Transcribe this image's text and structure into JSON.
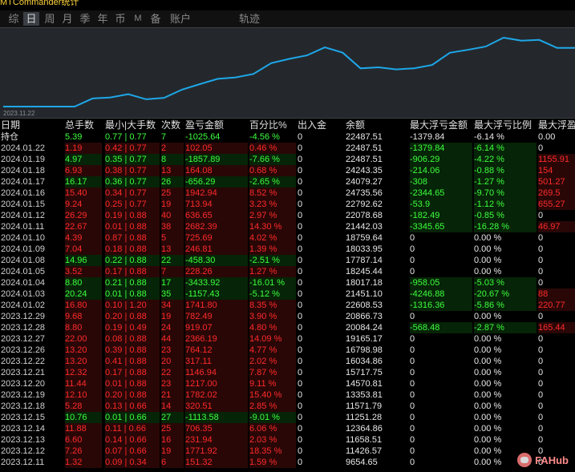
{
  "app": {
    "title": "MTCommander统计"
  },
  "tabs": [
    {
      "label": "综",
      "active": false
    },
    {
      "label": "日",
      "active": true
    },
    {
      "label": "周",
      "active": false
    },
    {
      "label": "月",
      "active": false
    },
    {
      "label": "季",
      "active": false
    },
    {
      "label": "年",
      "active": false
    },
    {
      "label": "币",
      "active": false
    },
    {
      "label": "M",
      "active": false
    },
    {
      "label": "备",
      "active": false
    },
    {
      "label": "账户",
      "active": false
    },
    {
      "label": "轨迹",
      "active": false
    }
  ],
  "chart_data": {
    "type": "line",
    "x_start_label": "2023.11.22",
    "line_color": "#1ea7e8",
    "values": [
      9654.65,
      9654.65,
      9654.65,
      9654.65,
      9654.65,
      11426.57,
      11658.51,
      12364.86,
      11251.28,
      11571.79,
      13353.81,
      14570.81,
      15717.75,
      16034.86,
      16798.98,
      19165.17,
      20084.24,
      20866.73,
      22608.53,
      21451.1,
      18017.18,
      18245.44,
      17787.14,
      18033.95,
      18759.64,
      21442.03,
      22078.68,
      22792.62,
      24735.56,
      24079.27,
      24243.35,
      22487.51,
      22487.51
    ]
  },
  "table": {
    "headers": [
      "日期",
      "总手数",
      "最小|大手数",
      "次数",
      "盈亏金额",
      "百分比%",
      "出入金",
      "余额",
      "最大浮亏金额",
      "最大浮亏比例",
      "最大浮盈"
    ],
    "holding": {
      "cells": [
        "持仓",
        "5.39",
        "0.77 | 0.77",
        "7",
        "-1025.64",
        "-4.56 %",
        "0",
        "22487.51",
        "-1379.84",
        "-6.14 %",
        "0.00"
      ],
      "color": "green"
    },
    "rows": [
      {
        "cells": [
          "2024.01.22",
          "1.19",
          "0.42 | 0.77",
          "2",
          "102.05",
          "0.46 %",
          "0",
          "22487.51",
          "-1379.84",
          "-6.14 %",
          "0"
        ],
        "color": "red",
        "float": "loss"
      },
      {
        "cells": [
          "2024.01.19",
          "4.97",
          "0.35 | 0.77",
          "8",
          "-1857.89",
          "-7.66 %",
          "0",
          "22487.51",
          "-906.29",
          "-4.22 %",
          "1155.91"
        ],
        "color": "green",
        "float": "both"
      },
      {
        "cells": [
          "2024.01.18",
          "6.93",
          "0.38 | 0.77",
          "13",
          "164.08",
          "0.68 %",
          "0",
          "24243.35",
          "-214.06",
          "-0.88 %",
          "154"
        ],
        "color": "red",
        "float": "both"
      },
      {
        "cells": [
          "2024.01.17",
          "16.17",
          "0.36 | 0.77",
          "26",
          "-656.29",
          "-2.65 %",
          "0",
          "24079.27",
          "-308",
          "-1.27 %",
          "501.27"
        ],
        "color": "green",
        "float": "both"
      },
      {
        "cells": [
          "2024.01.16",
          "15.40",
          "0.34 | 0.77",
          "25",
          "1942.94",
          "8.52 %",
          "0",
          "24735.56",
          "-2344.65",
          "-9.70 %",
          "269.5"
        ],
        "color": "red",
        "float": "both"
      },
      {
        "cells": [
          "2024.01.15",
          "9.24",
          "0.25 | 0.77",
          "19",
          "713.94",
          "3.23 %",
          "0",
          "22792.62",
          "-53.9",
          "-1.12 %",
          "655.27"
        ],
        "color": "red",
        "float": "both"
      },
      {
        "cells": [
          "2024.01.12",
          "26.29",
          "0.19 | 0.88",
          "40",
          "636.65",
          "2.97 %",
          "0",
          "22078.68",
          "-182.49",
          "-0.85 %",
          "0"
        ],
        "color": "red",
        "float": "loss"
      },
      {
        "cells": [
          "2024.01.11",
          "22.67",
          "0.01 | 0.88",
          "38",
          "2682.39",
          "14.30 %",
          "0",
          "21442.03",
          "-3345.65",
          "-16.28 %",
          "46.97"
        ],
        "color": "red",
        "float": "both"
      },
      {
        "cells": [
          "2024.01.10",
          "4.39",
          "0.87 | 0.88",
          "5",
          "725.69",
          "4.02 %",
          "0",
          "18759.64",
          "0",
          "0.00 %",
          "0"
        ],
        "color": "red",
        "float": "none"
      },
      {
        "cells": [
          "2024.01.09",
          "7.04",
          "0.18 | 0.88",
          "13",
          "246.81",
          "1.39 %",
          "0",
          "18033.95",
          "0",
          "0.00 %",
          "0"
        ],
        "color": "red",
        "float": "none"
      },
      {
        "cells": [
          "2024.01.08",
          "14.96",
          "0.22 | 0.88",
          "22",
          "-458.30",
          "-2.51 %",
          "0",
          "17787.14",
          "0",
          "0.00 %",
          "0"
        ],
        "color": "green",
        "float": "none"
      },
      {
        "cells": [
          "2024.01.05",
          "3.52",
          "0.17 | 0.88",
          "7",
          "228.26",
          "1.27 %",
          "0",
          "18245.44",
          "0",
          "0.00 %",
          "0"
        ],
        "color": "red",
        "float": "none"
      },
      {
        "cells": [
          "2024.01.04",
          "8.80",
          "0.21 | 0.88",
          "17",
          "-3433.92",
          "-16.01 %",
          "0",
          "18017.18",
          "-958.05",
          "-5.03 %",
          "0"
        ],
        "color": "green",
        "float": "loss"
      },
      {
        "cells": [
          "2024.01.03",
          "20.24",
          "0.01 | 0.88",
          "35",
          "-1157.43",
          "-5.12 %",
          "0",
          "21451.10",
          "-4246.88",
          "-20.67 %",
          "88"
        ],
        "color": "green",
        "float": "both"
      },
      {
        "cells": [
          "2024.01.02",
          "16.80",
          "0.10 | 1.20",
          "34",
          "1741.80",
          "8.35 %",
          "0",
          "22608.53",
          "-1316.36",
          "-5.86 %",
          "220.77"
        ],
        "color": "red",
        "float": "both"
      },
      {
        "cells": [
          "2023.12.29",
          "9.68",
          "0.20 | 0.88",
          "19",
          "782.49",
          "3.90 %",
          "0",
          "20866.73",
          "0",
          "0.00 %",
          "0"
        ],
        "color": "red",
        "float": "none"
      },
      {
        "cells": [
          "2023.12.28",
          "8.80",
          "0.19 | 0.49",
          "24",
          "919.07",
          "4.80 %",
          "0",
          "20084.24",
          "-568.48",
          "-2.87 %",
          "165.44"
        ],
        "color": "red",
        "float": "both"
      },
      {
        "cells": [
          "2023.12.27",
          "22.00",
          "0.08 | 0.88",
          "44",
          "2366.19",
          "14.09 %",
          "0",
          "19165.17",
          "0",
          "0.00 %",
          "0"
        ],
        "color": "red",
        "float": "none"
      },
      {
        "cells": [
          "2023.12.26",
          "13.20",
          "0.39 | 0.88",
          "23",
          "764.12",
          "4.77 %",
          "0",
          "16798.98",
          "0",
          "0.00 %",
          "0"
        ],
        "color": "red",
        "float": "none"
      },
      {
        "cells": [
          "2023.12.22",
          "13.20",
          "0.41 | 0.88",
          "20",
          "317.11",
          "2.02 %",
          "0",
          "16034.86",
          "0",
          "0.00 %",
          "0"
        ],
        "color": "red",
        "float": "none"
      },
      {
        "cells": [
          "2023.12.21",
          "12.32",
          "0.17 | 0.88",
          "22",
          "1146.94",
          "7.87 %",
          "0",
          "15717.75",
          "0",
          "0.00 %",
          "0"
        ],
        "color": "red",
        "float": "none"
      },
      {
        "cells": [
          "2023.12.20",
          "11.44",
          "0.01 | 0.88",
          "23",
          "1217.00",
          "9.11 %",
          "0",
          "14570.81",
          "0",
          "0.00 %",
          "0"
        ],
        "color": "red",
        "float": "none"
      },
      {
        "cells": [
          "2023.12.19",
          "12.10",
          "0.20 | 0.88",
          "21",
          "1782.02",
          "15.40 %",
          "0",
          "13353.81",
          "0",
          "0.00 %",
          "0"
        ],
        "color": "red",
        "float": "none"
      },
      {
        "cells": [
          "2023.12.18",
          "5.28",
          "0.13 | 0.66",
          "14",
          "320.51",
          "2.85 %",
          "0",
          "11571.79",
          "0",
          "0.00 %",
          "0"
        ],
        "color": "red",
        "float": "none"
      },
      {
        "cells": [
          "2023.12.15",
          "10.76",
          "0.01 | 0.66",
          "27",
          "-1113.58",
          "-9.01 %",
          "0",
          "11251.28",
          "0",
          "0.00 %",
          "0"
        ],
        "color": "green",
        "float": "none"
      },
      {
        "cells": [
          "2023.12.14",
          "11.88",
          "0.11 | 0.66",
          "25",
          "706.35",
          "6.06 %",
          "0",
          "12364.86",
          "0",
          "0.00 %",
          "0"
        ],
        "color": "red",
        "float": "none"
      },
      {
        "cells": [
          "2023.12.13",
          "6.60",
          "0.14 | 0.66",
          "16",
          "231.94",
          "2.03 %",
          "0",
          "11658.51",
          "0",
          "0.00 %",
          "0"
        ],
        "color": "red",
        "float": "none"
      },
      {
        "cells": [
          "2023.12.12",
          "7.26",
          "0.07 | 0.66",
          "19",
          "1771.92",
          "18.35 %",
          "0",
          "11426.57",
          "0",
          "0.00 %",
          "0"
        ],
        "color": "red",
        "float": "none"
      },
      {
        "cells": [
          "2023.12.11",
          "1.32",
          "0.09 | 0.34",
          "6",
          "151.32",
          "1.59 %",
          "0",
          "9654.65",
          "0",
          "0.00 %",
          "0"
        ],
        "color": "red",
        "float": "none"
      }
    ]
  },
  "watermark": {
    "text": "FAHub",
    "icon": "fahub-logo-icon"
  }
}
